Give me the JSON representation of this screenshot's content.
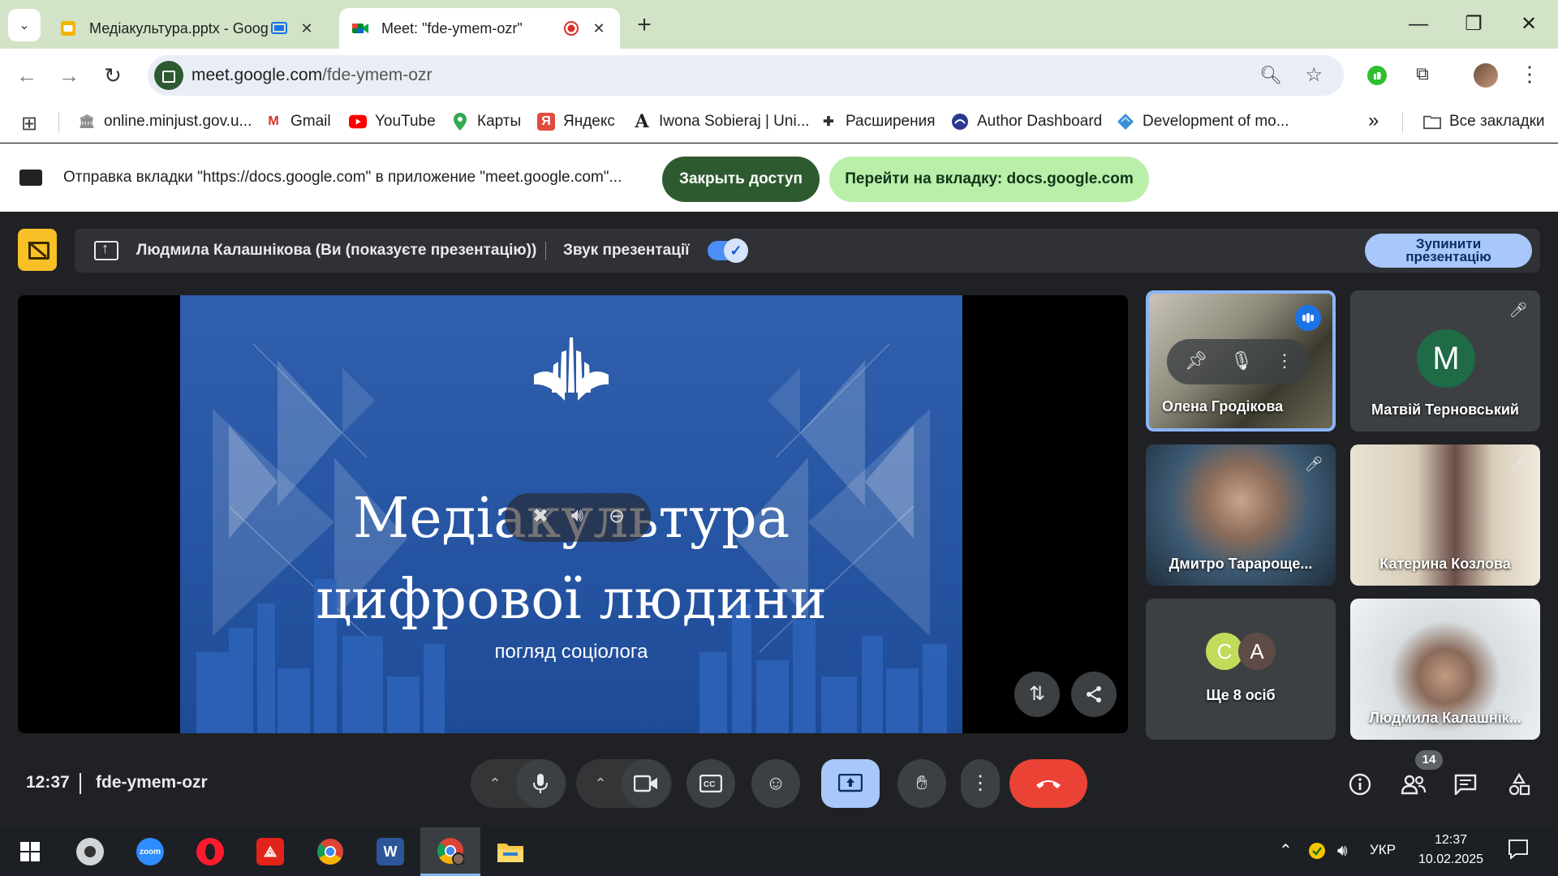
{
  "browser": {
    "tabs": [
      {
        "title": "Медіакультура.pptx - Google",
        "active": false
      },
      {
        "title": "Meet: \"fde-ymem-ozr\"",
        "active": true
      }
    ],
    "new_tab": "+",
    "window_controls": {
      "minimize": "—",
      "restore": "❐",
      "close": "✕"
    },
    "url_host": "meet.google.com",
    "url_path": "/fde-ymem-ozr",
    "bookmarks": [
      {
        "label": "online.minjust.gov.u...",
        "icon": "building-icon"
      },
      {
        "label": "Gmail",
        "icon": "gmail-icon"
      },
      {
        "label": "YouTube",
        "icon": "youtube-icon"
      },
      {
        "label": "Карты",
        "icon": "maps-pin-icon"
      },
      {
        "label": "Яндекс",
        "icon": "yandex-icon"
      },
      {
        "label": "Iwona Sobieraj | Uni...",
        "icon": "a-letter-icon"
      },
      {
        "label": "Расширения",
        "icon": "puzzle-icon"
      },
      {
        "label": "Author Dashboard",
        "icon": "dashboard-icon"
      },
      {
        "label": "Development of mo...",
        "icon": "diamond-icon"
      }
    ],
    "bookmarks_overflow": "»",
    "all_bookmarks": "Все закладки"
  },
  "infobar": {
    "text": "Отправка вкладки \"https://docs.google.com\" в приложение \"meet.google.com\"...",
    "stop_button": "Закрыть доступ",
    "switch_button": "Перейти на вкладку: docs.google.com"
  },
  "meet": {
    "presenting_label": "Людмила Калашнікова (Ви (показуєте презентацію))",
    "audio_label": "Звук презентації",
    "audio_on": true,
    "stop_presenting_line1": "Зупинити",
    "stop_presenting_line2": "презентацію",
    "slide": {
      "title_line1": "Медіакультура",
      "title_line2": "цифрової людини",
      "subtitle": "погляд соціолога"
    },
    "participants": [
      {
        "name": "Олена Гродікова",
        "speaking": true
      },
      {
        "name": "Матвій Терновський",
        "initial": "M",
        "muted": true
      },
      {
        "name": "Дмитро Тарароще...",
        "muted": true
      },
      {
        "name": "Катерина Козлова",
        "muted": true
      },
      {
        "name": "Ще 8 осіб",
        "initials": [
          "C",
          "A"
        ]
      },
      {
        "name": "Людмила Калашнік..."
      }
    ],
    "time": "12:37",
    "meeting_code": "fde-ymem-ozr",
    "people_count": "14"
  },
  "taskbar": {
    "apps": [
      "windows-start",
      "webcam",
      "zoom",
      "opera",
      "acrobat",
      "chrome",
      "word",
      "chrome-profile",
      "file-explorer"
    ],
    "zoom_label": "zoom",
    "language": "УКР",
    "time": "12:37",
    "date": "10.02.2025"
  },
  "colors": {
    "tabstrip": "#d3e3c7",
    "meet_bg": "#202124",
    "end_call": "#ea4335",
    "present_active": "#a8c7fa",
    "slide_blue": "#2f5fad"
  }
}
